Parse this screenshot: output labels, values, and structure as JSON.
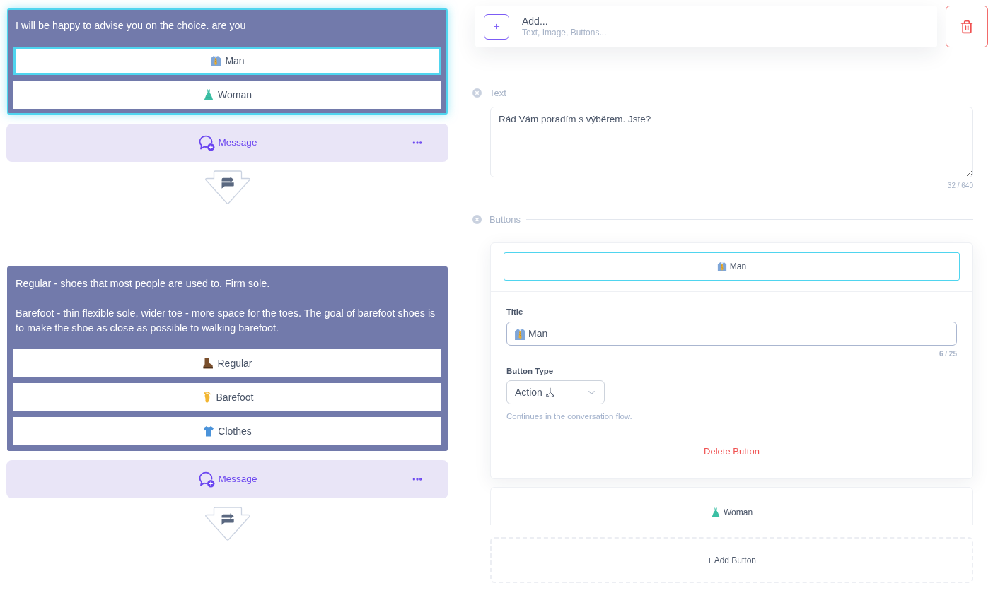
{
  "flow": {
    "blocks": [
      {
        "selected": true,
        "paragraphs": [
          "I will be happy to advise you on the choice. are you"
        ],
        "buttons": [
          {
            "kind": "necktie",
            "label": "Man",
            "selected": true
          },
          {
            "kind": "dress",
            "label": "Woman",
            "selected": false
          }
        ],
        "footer_label": "Message"
      },
      {
        "selected": false,
        "paragraphs": [
          "Regular - shoes that most people are used to. Firm sole.",
          "Barefoot - thin flexible sole, wider toe - more space for the toes. The goal of barefoot shoes is to make the shoe as close as possible to walking barefoot."
        ],
        "buttons": [
          {
            "kind": "boot",
            "label": "Regular",
            "selected": false
          },
          {
            "kind": "foot",
            "label": "Barefoot",
            "selected": false
          },
          {
            "kind": "tshirt",
            "label": "Clothes",
            "selected": false
          }
        ],
        "footer_label": "Message"
      }
    ]
  },
  "editor": {
    "add": {
      "title": "Add...",
      "subtitle": "Text, Image, Buttons..."
    },
    "text": {
      "label": "Text",
      "value": "Rád Vám poradím s výběrem. Jste?",
      "counter": "32 / 640"
    },
    "buttons": {
      "label": "Buttons",
      "items": [
        {
          "kind": "necktie",
          "label": "Man",
          "expanded": true,
          "form": {
            "title_label": "Title",
            "title_value": "Man",
            "title_counter": "6 / 25",
            "type_label": "Button Type",
            "type_value": "Action",
            "type_hint": "Continues in the conversation flow.",
            "delete_label": "Delete Button"
          }
        },
        {
          "kind": "dress",
          "label": "Woman",
          "expanded": false
        }
      ],
      "add_label": "+ Add Button"
    }
  }
}
